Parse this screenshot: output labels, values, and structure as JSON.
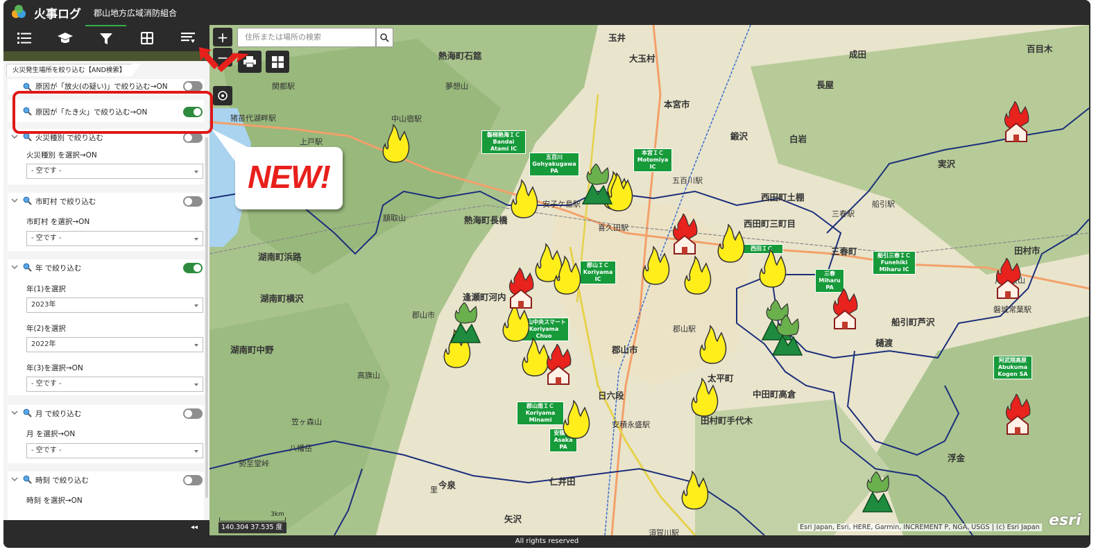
{
  "header": {
    "title": "火事ログ",
    "subtitle": "郡山地方広域消防組合"
  },
  "toolbar": {
    "buttons": [
      {
        "name": "list-icon"
      },
      {
        "name": "graduation-cap-icon"
      },
      {
        "name": "filter-icon"
      },
      {
        "name": "grid-icon"
      },
      {
        "name": "legend-icon"
      }
    ],
    "active": "filter-icon"
  },
  "panel": {
    "tab_label": "火災発生場所を絞り込む【AND検索】",
    "filters": [
      {
        "label": "原因が「放火(の疑い)」で絞り込む→ON",
        "on": false
      },
      {
        "label": "原因が「たき火」で絞り込む→ON",
        "on": true
      },
      {
        "label": "火災種別 で絞り込む",
        "on": false,
        "sub_label": "火災種別 を選択→ON",
        "select": "- 空です -"
      },
      {
        "label": "市町村 で絞り込む",
        "on": false,
        "sub_label": "市町村 を選択→ON",
        "select": "- 空です -"
      },
      {
        "label": "年 で絞り込む",
        "on": true,
        "year1_label": "年(1)を選択",
        "year1": "2023年",
        "year2_label": "年(2)を選択",
        "year2": "2022年",
        "year3_label": "年(3)を選択→ON",
        "year3": "- 空です -"
      },
      {
        "label": "月 で絞り込む",
        "on": false,
        "sub_label": "月 を選択→ON",
        "select": "- 空です -"
      },
      {
        "label": "時刻 で絞り込む",
        "on": false,
        "sub_label": "時刻 を選択→ON"
      }
    ],
    "collapse_label": "◂◂"
  },
  "map": {
    "search_placeholder": "住所または場所の検索",
    "zoom_in": "+",
    "zoom_out": "−",
    "scale_label": "3km",
    "coords": "140.304 37.535 度",
    "attribution": "Esri Japan, Esri, HERE, Garmin, INCREMENT P, NGA, USGS | (c) Esri Japan",
    "esri_logo": "esri",
    "place_labels": [
      {
        "text": "郡山市",
        "cls": "big"
      },
      {
        "text": "本宮市",
        "cls": "big"
      },
      {
        "text": "田村市",
        "cls": "big"
      },
      {
        "text": "熱海町石筵",
        "cls": "big"
      },
      {
        "text": "熱海町長橋",
        "cls": "big"
      },
      {
        "text": "湖南町浜路",
        "cls": "big"
      },
      {
        "text": "湖南町横沢",
        "cls": "big"
      },
      {
        "text": "湖南町中野",
        "cls": "big"
      },
      {
        "text": "逢瀬町河内",
        "cls": "big"
      },
      {
        "text": "西田町土棚",
        "cls": "big"
      },
      {
        "text": "西田町三町目",
        "cls": "big"
      },
      {
        "text": "田村町手代木",
        "cls": "big"
      },
      {
        "text": "中田町高倉",
        "cls": "big"
      },
      {
        "text": "船引町芦沢",
        "cls": "big"
      },
      {
        "text": "大玉村",
        "cls": "big"
      },
      {
        "text": "玉井",
        "cls": "big"
      },
      {
        "text": "長屋",
        "cls": "big"
      },
      {
        "text": "成田",
        "cls": "big"
      },
      {
        "text": "百目木",
        "cls": "big"
      },
      {
        "text": "実沢",
        "cls": "big"
      },
      {
        "text": "白岩",
        "cls": "big"
      },
      {
        "text": "鍛沢",
        "cls": "big"
      },
      {
        "text": "日六段",
        "cls": "big"
      },
      {
        "text": "仁井田",
        "cls": "big"
      },
      {
        "text": "浮金",
        "cls": "big"
      },
      {
        "text": "今泉",
        "cls": "big"
      },
      {
        "text": "矢沢",
        "cls": "big"
      },
      {
        "text": "三春町",
        "cls": "big"
      },
      {
        "text": "樋渡",
        "cls": "big"
      },
      {
        "text": "太平町",
        "cls": "big"
      },
      {
        "text": "郡山駅",
        "cls": ""
      },
      {
        "text": "安子ケ島駅",
        "cls": ""
      },
      {
        "text": "喜久田駅",
        "cls": ""
      },
      {
        "text": "中山宿駅",
        "cls": ""
      },
      {
        "text": "上戸駅",
        "cls": ""
      },
      {
        "text": "関都駅",
        "cls": ""
      },
      {
        "text": "猪苗代湖畔駅",
        "cls": ""
      },
      {
        "text": "五百川駅",
        "cls": ""
      },
      {
        "text": "三春駅",
        "cls": ""
      },
      {
        "text": "安積永盛駅",
        "cls": ""
      },
      {
        "text": "須賀川駅",
        "cls": ""
      },
      {
        "text": "船引駅",
        "cls": ""
      },
      {
        "text": "磐城常葉駅",
        "cls": ""
      },
      {
        "text": "片曽根山",
        "cls": ""
      },
      {
        "text": "夢想山",
        "cls": ""
      },
      {
        "text": "額取山",
        "cls": ""
      },
      {
        "text": "高旗山",
        "cls": ""
      },
      {
        "text": "笠ヶ森山",
        "cls": ""
      },
      {
        "text": "八幡岳",
        "cls": ""
      },
      {
        "text": "勢至堂峠",
        "cls": ""
      },
      {
        "text": "郡山市",
        "cls": ""
      },
      {
        "text": "里",
        "cls": ""
      }
    ],
    "ic_badges": [
      "磐梯熱海ＩＣ Bandai Atami IC",
      "五百川 Gohyakugawa PA",
      "本宮ＩＣ Motomiya IC",
      "郡山ＩＣ Koriyama IC",
      "郡山中央スマート Koriyama Chuo",
      "郡山南ＩＣ Koriyama Minami",
      "安積PA Asaka PA",
      "三春 Miharu PA",
      "船引三春ＩＣ Funehiki Miharu IC",
      "阿武隈高原 Abukuma Kogen SA",
      "西田ＩＣ"
    ]
  },
  "annotation": {
    "callout": "NEW!"
  },
  "footer": {
    "text": "All rights reserved"
  }
}
